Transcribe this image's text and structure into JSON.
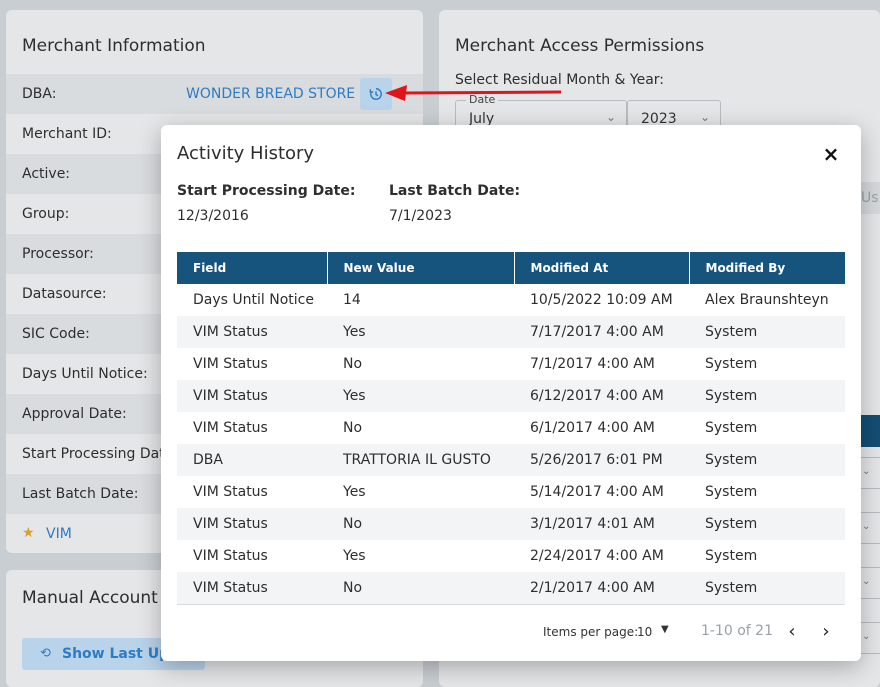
{
  "merchant_info": {
    "title": "Merchant Information",
    "rows": [
      {
        "label": "DBA:",
        "value": "WONDER BREAD STORE"
      },
      {
        "label": "Merchant ID:"
      },
      {
        "label": "Active:"
      },
      {
        "label": "Group:"
      },
      {
        "label": "Processor:"
      },
      {
        "label": "Datasource:"
      },
      {
        "label": "SIC Code:"
      },
      {
        "label": "Days Until Notice:"
      },
      {
        "label": "Approval Date:"
      },
      {
        "label": "Start Processing Date"
      },
      {
        "label": "Last Batch Date:"
      }
    ],
    "vim_link": "VIM"
  },
  "manual_account": {
    "title": "Manual Account",
    "show_button": "Show Last Upd"
  },
  "access_permissions": {
    "title": "Merchant Access Permissions",
    "select_label": "Select Residual Month & Year:",
    "date_label": "Date",
    "month_value": "July",
    "year_value": "2023",
    "partial_button": "Us"
  },
  "dialog": {
    "title": "Activity History",
    "close_glyph": "×",
    "start_label": "Start Processing Date:",
    "start_value": "12/3/2016",
    "last_batch_label": "Last Batch Date:",
    "last_batch_value": "7/1/2023",
    "columns": [
      "Field",
      "New Value",
      "Modified At",
      "Modified By"
    ],
    "rows": [
      [
        "Days Until Notice",
        "14",
        "10/5/2022 10:09 AM",
        "Alex Braunshteyn"
      ],
      [
        "VIM Status",
        "Yes",
        "7/17/2017 4:00 AM",
        "System"
      ],
      [
        "VIM Status",
        "No",
        "7/1/2017 4:00 AM",
        "System"
      ],
      [
        "VIM Status",
        "Yes",
        "6/12/2017 4:00 AM",
        "System"
      ],
      [
        "VIM Status",
        "No",
        "6/1/2017 4:00 AM",
        "System"
      ],
      [
        "DBA",
        "TRATTORIA IL GUSTO",
        "5/26/2017 6:01 PM",
        "System"
      ],
      [
        "VIM Status",
        "Yes",
        "5/14/2017 4:00 AM",
        "System"
      ],
      [
        "VIM Status",
        "No",
        "3/1/2017 4:01 AM",
        "System"
      ],
      [
        "VIM Status",
        "Yes",
        "2/24/2017 4:00 AM",
        "System"
      ],
      [
        "VIM Status",
        "No",
        "2/1/2017 4:00 AM",
        "System"
      ]
    ],
    "pager": {
      "items_per_page_label": "Items per page:",
      "items_per_page_value": "10",
      "range": "1-10 of 21"
    }
  },
  "colors": {
    "header_blue": "#16547e",
    "link_blue": "#2f7bc3",
    "arrow_red": "#e0151b"
  }
}
